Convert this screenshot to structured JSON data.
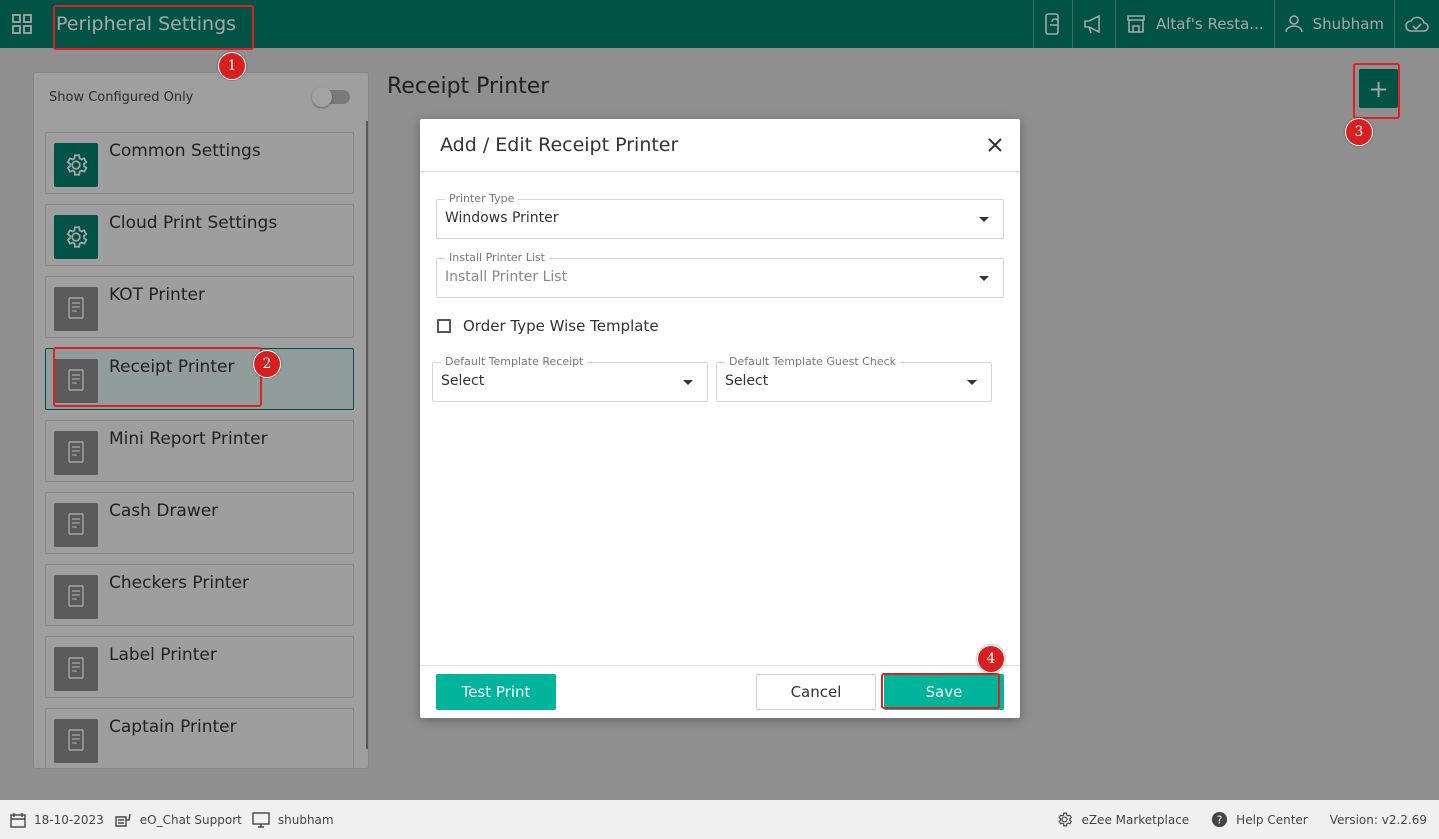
{
  "header": {
    "app_title": "Peripheral Settings",
    "restaurant": "Altaf's Resta...",
    "user": "Shubham",
    "icons": [
      "apps-grid-icon",
      "mobile-order-icon",
      "megaphone-icon",
      "store-icon",
      "user-icon",
      "cloud-check-icon"
    ]
  },
  "page": {
    "title": "Receipt Printer",
    "add_button": "+"
  },
  "sidebar": {
    "filter_label": "Show Configured Only",
    "filter_on": false,
    "items": [
      {
        "label": "Common Settings",
        "icon": "gear-icon",
        "green": true
      },
      {
        "label": "Cloud Print Settings",
        "icon": "gear-icon",
        "green": true
      },
      {
        "label": "KOT Printer",
        "icon": "kot-printer-icon",
        "green": false
      },
      {
        "label": "Receipt Printer",
        "icon": "receipt-icon",
        "green": false,
        "active": true
      },
      {
        "label": "Mini Report Printer",
        "icon": "report-printer-icon",
        "green": false
      },
      {
        "label": "Cash Drawer",
        "icon": "cash-register-icon",
        "green": false
      },
      {
        "label": "Checkers Printer",
        "icon": "checker-icon",
        "green": false
      },
      {
        "label": "Label Printer",
        "icon": "label-printer-icon",
        "green": false
      },
      {
        "label": "Captain Printer",
        "icon": "captain-icon",
        "green": false
      }
    ]
  },
  "modal": {
    "title": "Add / Edit Receipt Printer",
    "printer_type": {
      "legend": "Printer Type",
      "value": "Windows Printer"
    },
    "install_printer": {
      "legend": "Install Printer List",
      "placeholder": "Install Printer List"
    },
    "order_type_checkbox": {
      "label": "Order Type Wise Template",
      "checked": false
    },
    "template_receipt": {
      "legend": "Default Template Receipt",
      "value": "Select"
    },
    "template_guest": {
      "legend": "Default Template Guest Check",
      "value": "Select"
    },
    "test_print": "Test Print",
    "cancel": "Cancel",
    "save": "Save"
  },
  "annotations": [
    "1",
    "2",
    "3",
    "4"
  ],
  "status": {
    "date": "18-10-2023",
    "chat": "eO_Chat Support",
    "terminal": "shubham",
    "marketplace": "eZee Marketplace",
    "help": "Help Center",
    "version": "Version: v2.2.69"
  },
  "colors": {
    "primary": "#00806b",
    "accent": "#00b39b",
    "annotation": "#d81f1f"
  }
}
